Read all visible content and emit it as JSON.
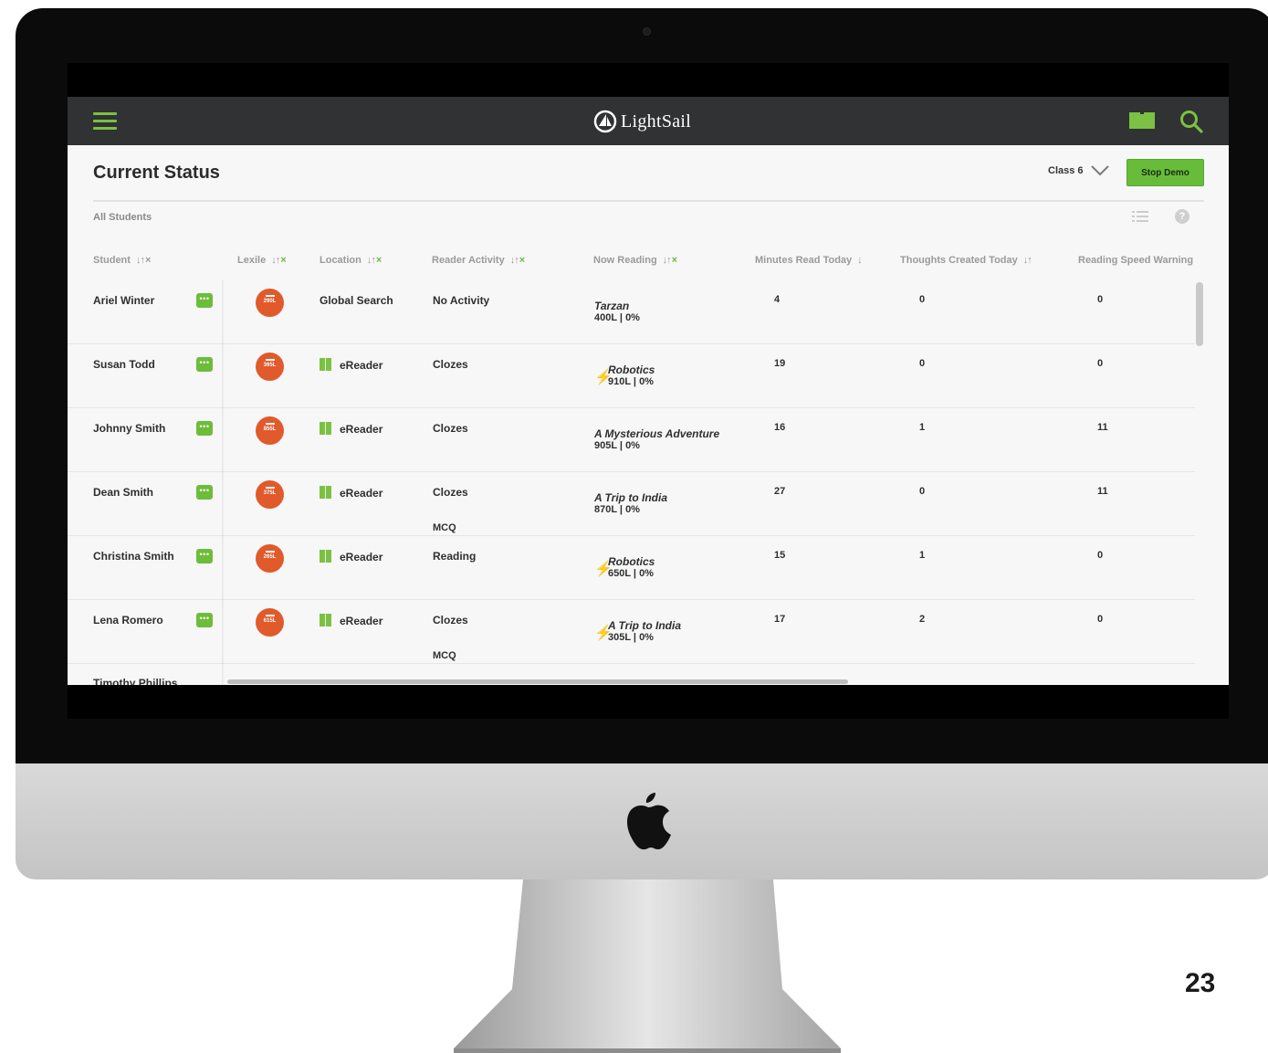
{
  "app": {
    "brand": "LightSail",
    "accent": "#67bd3a",
    "lexile_badge_color": "#e05a2b",
    "topbar_color": "#303233"
  },
  "header": {
    "title": "Current Status",
    "class_selector": "Class 6",
    "stop_demo_label": "Stop Demo",
    "filter_label": "All Students"
  },
  "table": {
    "columns": [
      "Student",
      "Lexile",
      "Location",
      "Reader Activity",
      "Now Reading",
      "Minutes Read Today",
      "Thoughts Created Today",
      "Reading Speed Warning"
    ],
    "rows": [
      {
        "student": "Ariel Winter",
        "lexile": "290L",
        "location": "Global Search",
        "location_icon": "",
        "activity": "No Activity",
        "activity2": "",
        "book_title": "Tarzan",
        "book_meta": "400L | 0%",
        "lightning": false,
        "minutes": "4",
        "thoughts": "0",
        "speed": "0"
      },
      {
        "student": "Susan Todd",
        "lexile": "365L",
        "location": "eReader",
        "location_icon": "ereader-icon",
        "activity": "Clozes",
        "activity2": "",
        "book_title": "Robotics",
        "book_meta": "910L | 0%",
        "lightning": true,
        "minutes": "19",
        "thoughts": "0",
        "speed": "0"
      },
      {
        "student": "Johnny Smith",
        "lexile": "855L",
        "location": "eReader",
        "location_icon": "ereader-icon",
        "activity": "Clozes",
        "activity2": "",
        "book_title": "A Mysterious Adventure",
        "book_meta": "905L | 0%",
        "lightning": false,
        "minutes": "16",
        "thoughts": "1",
        "speed": "11"
      },
      {
        "student": "Dean Smith",
        "lexile": "375L",
        "location": "eReader",
        "location_icon": "ereader-icon",
        "activity": "Clozes",
        "activity2": "MCQ",
        "book_title": "A Trip to India",
        "book_meta": "870L | 0%",
        "lightning": false,
        "minutes": "27",
        "thoughts": "0",
        "speed": "11"
      },
      {
        "student": "Christina Smith",
        "lexile": "265L",
        "location": "eReader",
        "location_icon": "ereader-icon",
        "activity": "Reading",
        "activity2": "",
        "book_title": "Robotics",
        "book_meta": "650L | 0%",
        "lightning": true,
        "minutes": "15",
        "thoughts": "1",
        "speed": "0"
      },
      {
        "student": "Lena Romero",
        "lexile": "615L",
        "location": "eReader",
        "location_icon": "ereader-icon",
        "activity": "Clozes",
        "activity2": "MCQ",
        "book_title": "A Trip to India",
        "book_meta": "305L | 0%",
        "lightning": true,
        "minutes": "17",
        "thoughts": "2",
        "speed": "0"
      }
    ],
    "partial_row_student": "Timothy Phillips"
  },
  "page_number": "23"
}
